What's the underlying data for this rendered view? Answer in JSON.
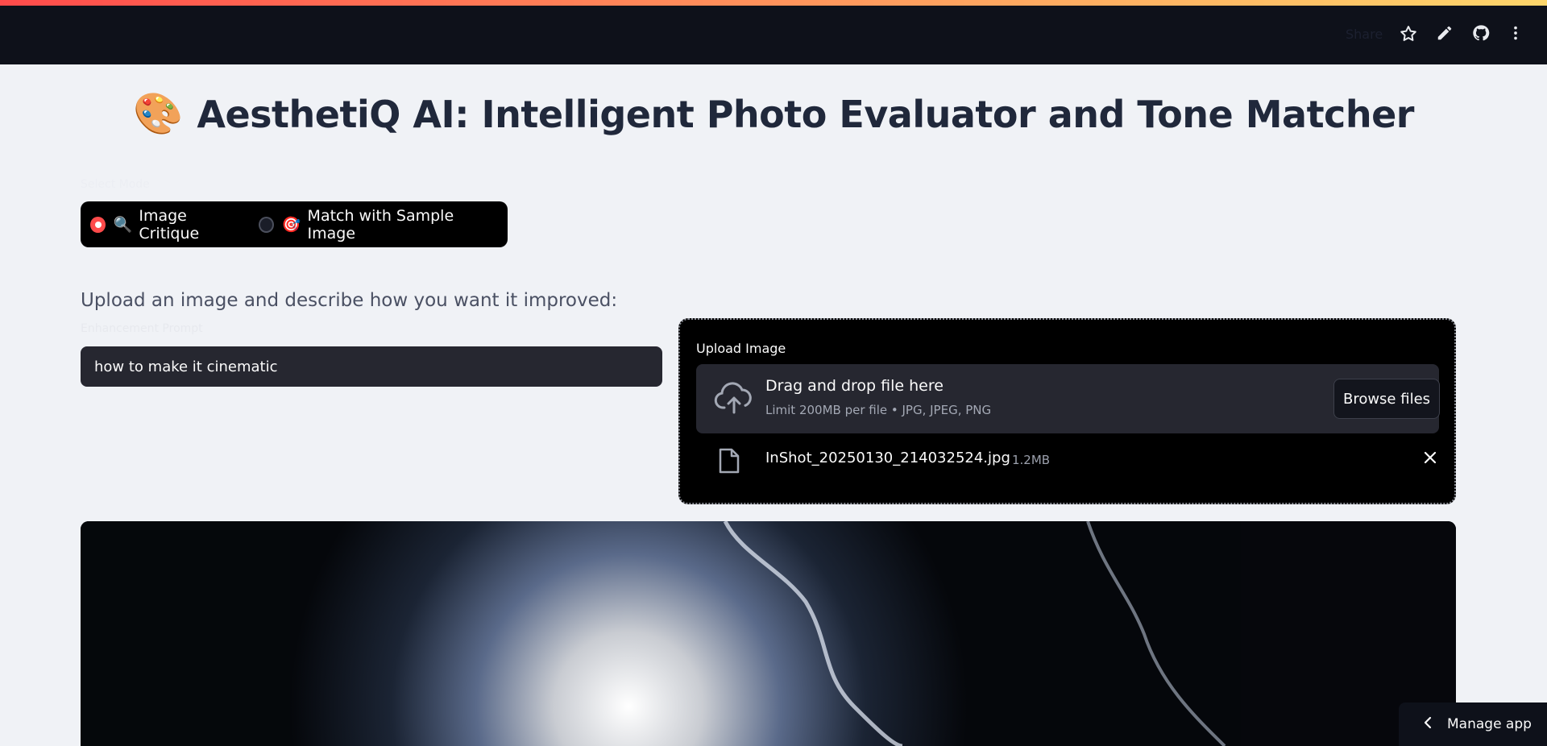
{
  "header": {
    "share_label": "Share",
    "icons": [
      "star-icon",
      "pencil-icon",
      "github-icon",
      "more-vertical-icon"
    ]
  },
  "main": {
    "title_emoji": "🎨",
    "title": "AesthetiQ AI: Intelligent Photo Evaluator and Tone Matcher",
    "mode": {
      "label": "Select Mode",
      "options": [
        {
          "emoji": "🔍",
          "label": "Image Critique",
          "selected": true
        },
        {
          "emoji": "🎯",
          "label": "Match with Sample Image",
          "selected": false
        }
      ]
    },
    "subheading": "Upload an image and describe how you want it improved:",
    "prompt": {
      "label": "Enhancement Prompt",
      "value": "how to make it cinematic"
    },
    "upload": {
      "label": "Upload Image",
      "drop_title": "Drag and drop file here",
      "limit_text": "Limit 200MB per file • JPG, JPEG, PNG",
      "browse_label": "Browse files",
      "file": {
        "name": "InShot_20250130_214032524.jpg",
        "size": "1.2MB"
      }
    }
  },
  "footer": {
    "manage_label": "Manage app"
  },
  "colors": {
    "accent": "#ff4b4b",
    "page_bg": "#f0f2f6",
    "topbar_bg": "#0e111a",
    "widget_bg": "#262730"
  }
}
